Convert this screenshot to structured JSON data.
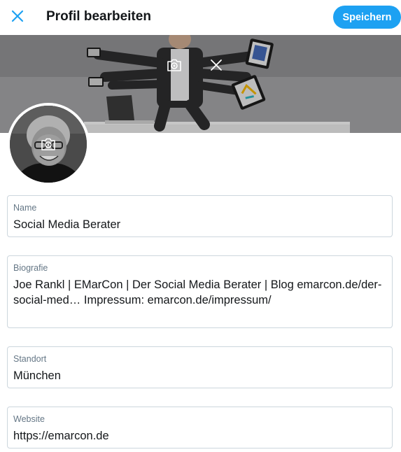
{
  "header": {
    "title": "Profil bearbeiten",
    "save_label": "Speichern",
    "accent_color": "#1da1f2"
  },
  "icons": {
    "close": "close-icon",
    "banner_camera": "camera-icon",
    "banner_remove": "x-icon",
    "avatar_camera": "camera-icon"
  },
  "form": {
    "name": {
      "label": "Name",
      "value": "Social Media Berater"
    },
    "bio": {
      "label": "Biografie",
      "value_line1": "Joe Rankl | EMarCon | Der Social Media Berater | Blog emarcon.de/der-",
      "value_line2": "social-med… Impressum: emarcon.de/impressum/"
    },
    "location": {
      "label": "Standort",
      "value": "München"
    },
    "website": {
      "label": "Website",
      "value": "https://emarcon.de"
    }
  }
}
